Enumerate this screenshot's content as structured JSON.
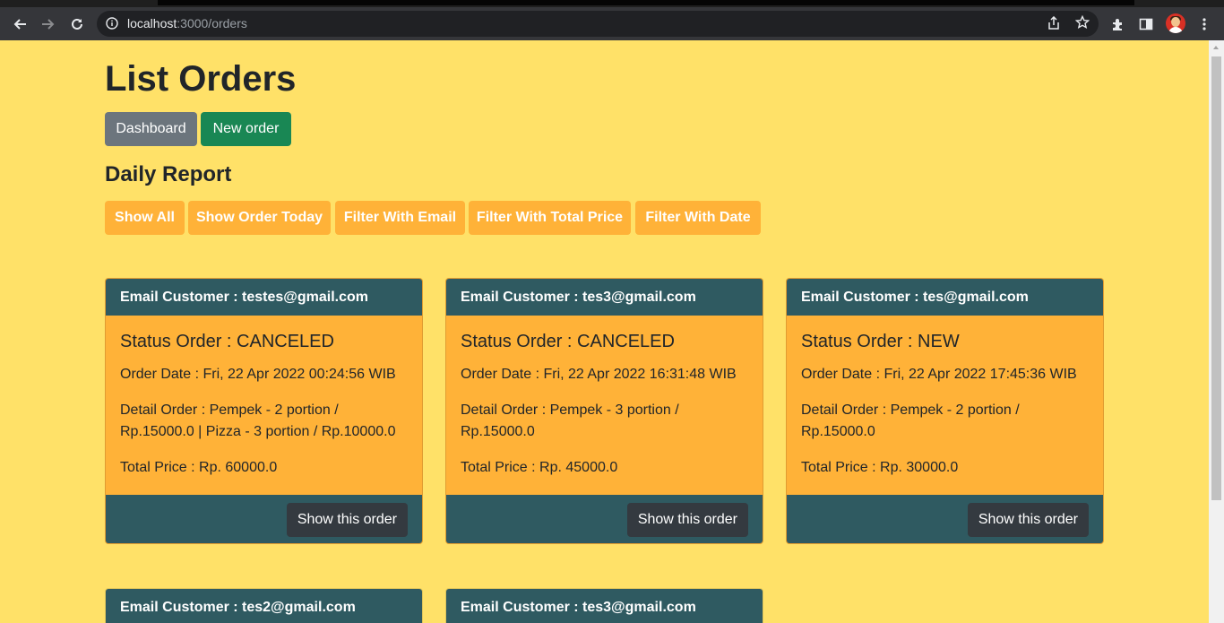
{
  "browser": {
    "url_host": "localhost",
    "url_path": ":3000/orders"
  },
  "page": {
    "title": "List Orders",
    "dashboard_label": "Dashboard",
    "new_order_label": "New order",
    "daily_report_label": "Daily Report",
    "filters": [
      {
        "label": "Show All"
      },
      {
        "label": "Show Order Today"
      },
      {
        "label": "Filter With Email"
      },
      {
        "label": "Filter With Total Price"
      },
      {
        "label": "Filter With Date"
      }
    ]
  },
  "orders": [
    {
      "email": "Email Customer : testes@gmail.com",
      "status": "Status Order : CANCELED",
      "date": "Order Date : Fri, 22 Apr 2022 00:24:56 WIB",
      "detail": "Detail Order : Pempek - 2 portion / Rp.15000.0 | Pizza - 3 portion / Rp.10000.0",
      "total": "Total Price : Rp. 60000.0",
      "button": "Show this order"
    },
    {
      "email": "Email Customer : tes3@gmail.com",
      "status": "Status Order : CANCELED",
      "date": "Order Date : Fri, 22 Apr 2022 16:31:48 WIB",
      "detail": "Detail Order : Pempek - 3 portion / Rp.15000.0",
      "total": "Total Price : Rp. 45000.0",
      "button": "Show this order"
    },
    {
      "email": "Email Customer : tes@gmail.com",
      "status": "Status Order : NEW",
      "date": "Order Date : Fri, 22 Apr 2022 17:45:36 WIB",
      "detail": "Detail Order : Pempek - 2 portion / Rp.15000.0",
      "total": "Total Price : Rp. 30000.0",
      "button": "Show this order"
    },
    {
      "email": "Email Customer : tes2@gmail.com"
    },
    {
      "email": "Email Customer : tes3@gmail.com"
    }
  ],
  "colors": {
    "page_bg": "#ffe168",
    "card_header": "#2f5a61",
    "card_body": "#ffb238",
    "filter_btn": "#ffb238",
    "dashboard_btn": "#6c757d",
    "new_btn": "#198754",
    "show_btn": "#343a40"
  },
  "icons": [
    "back-arrow-icon",
    "forward-arrow-icon",
    "reload-icon",
    "info-icon",
    "share-icon",
    "star-icon",
    "extensions-icon",
    "side-panel-icon",
    "avatar",
    "menu-dots-icon"
  ]
}
